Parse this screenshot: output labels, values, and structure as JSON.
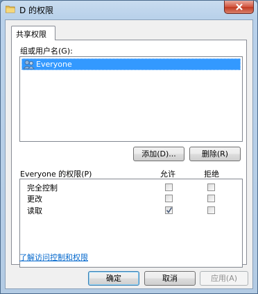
{
  "window": {
    "title": "D 的权限"
  },
  "tab": {
    "label": "共享权限"
  },
  "group_section": {
    "label": "组或用户名(G):",
    "users": [
      {
        "name": "Everyone",
        "selected": true
      }
    ],
    "add_button": "添加(D)...",
    "remove_button": "删除(R)"
  },
  "permissions": {
    "header_label": "Everyone 的权限(P)",
    "allow_header": "允许",
    "deny_header": "拒绝",
    "rows": [
      {
        "name": "完全控制",
        "allow": false,
        "deny": false
      },
      {
        "name": "更改",
        "allow": false,
        "deny": false
      },
      {
        "name": "读取",
        "allow": true,
        "deny": false
      }
    ]
  },
  "help_link": "了解访问控制和权限",
  "footer": {
    "ok": "确定",
    "cancel": "取消",
    "apply": "应用(A)"
  },
  "colors": {
    "selection": "#3399ff",
    "link": "#0066cc",
    "close_button": "#c23a21"
  }
}
